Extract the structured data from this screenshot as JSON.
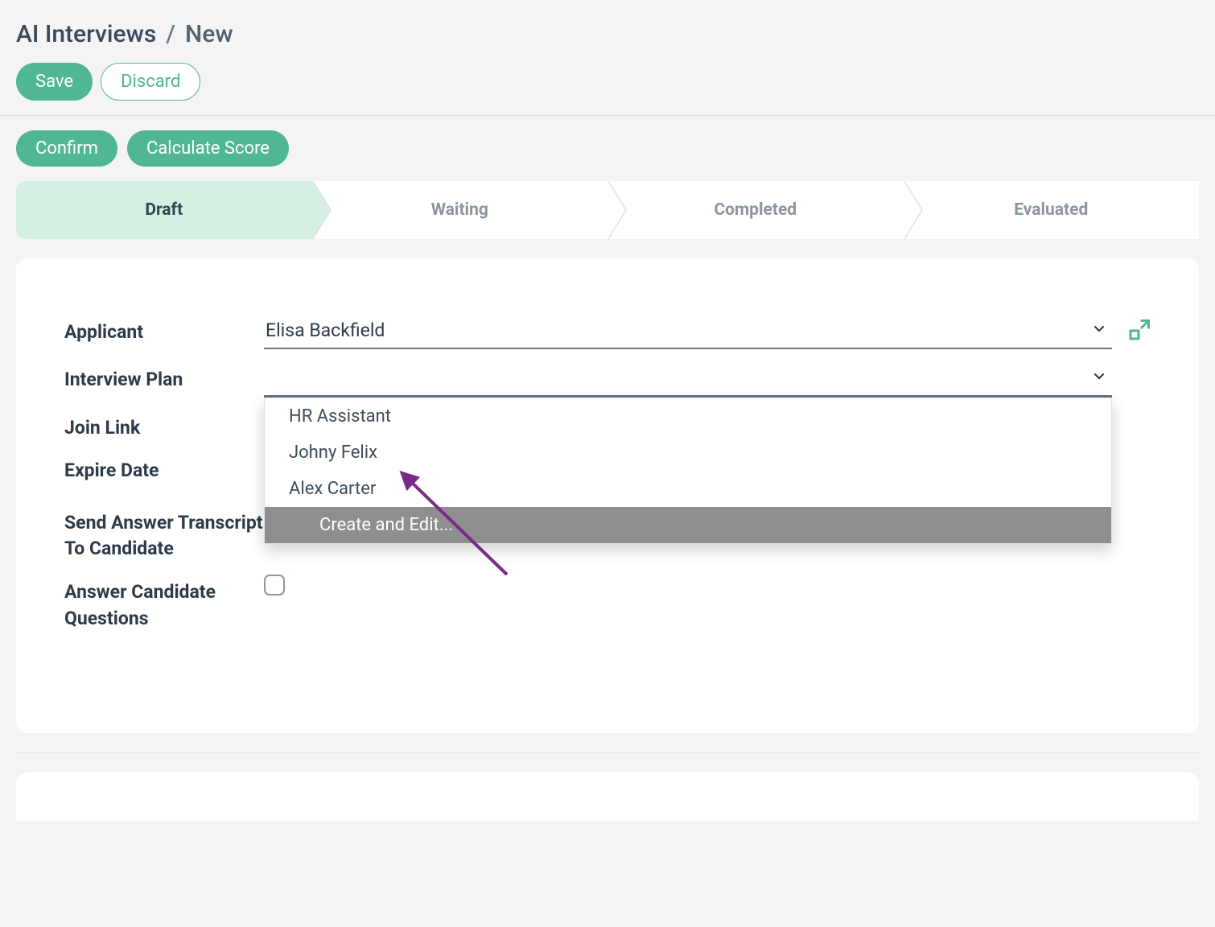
{
  "breadcrumb": {
    "root": "AI Interviews",
    "current": "New"
  },
  "buttons": {
    "save": "Save",
    "discard": "Discard",
    "confirm": "Confirm",
    "calculate_score": "Calculate Score"
  },
  "status_steps": [
    "Draft",
    "Waiting",
    "Completed",
    "Evaluated"
  ],
  "status_active_index": 0,
  "form": {
    "applicant": {
      "label": "Applicant",
      "value": "Elisa Backfield"
    },
    "interview_plan": {
      "label": "Interview Plan",
      "value": "",
      "options": [
        "HR Assistant",
        "Johny Felix",
        "Alex Carter"
      ],
      "action_label": "Create and Edit..."
    },
    "join_link": {
      "label": "Join Link"
    },
    "expire_date": {
      "label": "Expire Date"
    },
    "send_transcript": {
      "label": "Send Answer Transcript To Candidate"
    },
    "answer_questions": {
      "label": "Answer Candidate Questions",
      "checked": false
    }
  },
  "colors": {
    "primary": "#4fb796",
    "annotation": "#7c2a8a"
  }
}
